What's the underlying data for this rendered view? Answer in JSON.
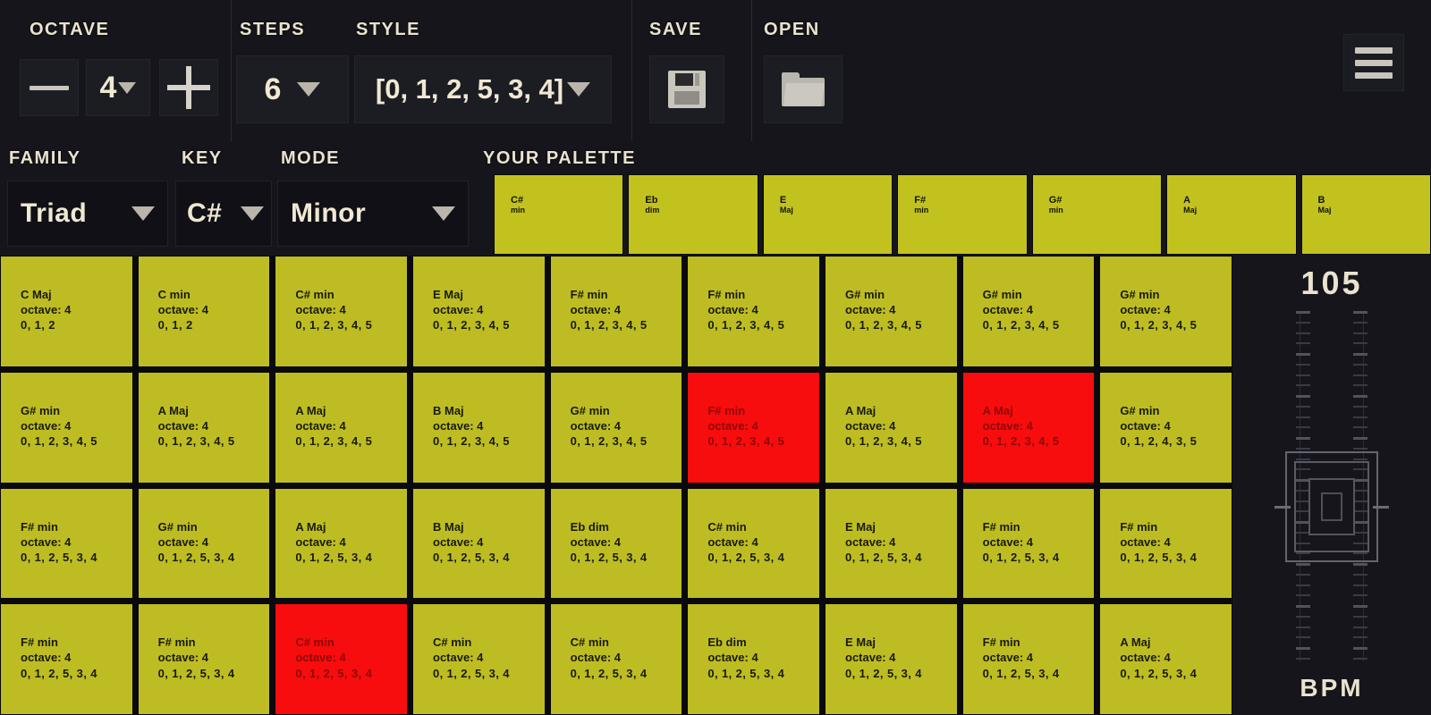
{
  "toolbar": {
    "octave": {
      "label": "OCTAVE",
      "decrement_icon": "minus-icon",
      "value": "4",
      "increment_icon": "plus-icon"
    },
    "steps": {
      "label": "STEPS",
      "value": "6"
    },
    "style": {
      "label": "STYLE",
      "value": "[0, 1, 2, 5, 3, 4]"
    },
    "save": {
      "label": "SAVE",
      "icon": "floppy-disk-icon"
    },
    "open": {
      "label": "OPEN",
      "icon": "folder-icon"
    },
    "menu": {
      "icon": "hamburger-menu-icon"
    }
  },
  "selectors": {
    "family": {
      "label": "FAMILY",
      "value": "Triad"
    },
    "key": {
      "label": "KEY",
      "value": "C#"
    },
    "mode": {
      "label": "MODE",
      "value": "Minor"
    }
  },
  "palette": {
    "label": "YOUR PALETTE",
    "chips": [
      {
        "root": "C#",
        "quality": "min"
      },
      {
        "root": "Eb",
        "quality": "dim"
      },
      {
        "root": "E",
        "quality": "Maj"
      },
      {
        "root": "F#",
        "quality": "min"
      },
      {
        "root": "G#",
        "quality": "min"
      },
      {
        "root": "A",
        "quality": "Maj"
      },
      {
        "root": "B",
        "quality": "Maj"
      }
    ]
  },
  "grid": {
    "rows": 4,
    "columns": 9,
    "active_color": "#f70d0d",
    "idle_color": "#bdbd23",
    "cells": [
      {
        "chord": "C Maj",
        "octave": "octave: 4",
        "steps": "0, 1, 2",
        "active": false
      },
      {
        "chord": "C min",
        "octave": "octave: 4",
        "steps": "0, 1, 2",
        "active": false
      },
      {
        "chord": "C# min",
        "octave": "octave: 4",
        "steps": "0, 1, 2, 3, 4, 5",
        "active": false
      },
      {
        "chord": "E Maj",
        "octave": "octave: 4",
        "steps": "0, 1, 2, 3, 4, 5",
        "active": false
      },
      {
        "chord": "F# min",
        "octave": "octave: 4",
        "steps": "0, 1, 2, 3, 4, 5",
        "active": false
      },
      {
        "chord": "F# min",
        "octave": "octave: 4",
        "steps": "0, 1, 2, 3, 4, 5",
        "active": false
      },
      {
        "chord": "G# min",
        "octave": "octave: 4",
        "steps": "0, 1, 2, 3, 4, 5",
        "active": false
      },
      {
        "chord": "G# min",
        "octave": "octave: 4",
        "steps": "0, 1, 2, 3, 4, 5",
        "active": false
      },
      {
        "chord": "G# min",
        "octave": "octave: 4",
        "steps": "0, 1, 2, 3, 4, 5",
        "active": false
      },
      {
        "chord": "G# min",
        "octave": "octave: 4",
        "steps": "0, 1, 2, 3, 4, 5",
        "active": false
      },
      {
        "chord": "A Maj",
        "octave": "octave: 4",
        "steps": "0, 1, 2, 3, 4, 5",
        "active": false
      },
      {
        "chord": "A Maj",
        "octave": "octave: 4",
        "steps": "0, 1, 2, 3, 4, 5",
        "active": false
      },
      {
        "chord": "B Maj",
        "octave": "octave: 4",
        "steps": "0, 1, 2, 3, 4, 5",
        "active": false
      },
      {
        "chord": "G# min",
        "octave": "octave: 4",
        "steps": "0, 1, 2, 3, 4, 5",
        "active": false
      },
      {
        "chord": "F# min",
        "octave": "octave: 4",
        "steps": "0, 1, 2, 3, 4, 5",
        "active": true
      },
      {
        "chord": "A Maj",
        "octave": "octave: 4",
        "steps": "0, 1, 2, 3, 4, 5",
        "active": false
      },
      {
        "chord": "A Maj",
        "octave": "octave: 4",
        "steps": "0, 1, 2, 3, 4, 5",
        "active": true
      },
      {
        "chord": "G# min",
        "octave": "octave: 4",
        "steps": "0, 1, 2, 4, 3, 5",
        "active": false
      },
      {
        "chord": "F# min",
        "octave": "octave: 4",
        "steps": "0, 1, 2, 5, 3, 4",
        "active": false
      },
      {
        "chord": "G# min",
        "octave": "octave: 4",
        "steps": "0, 1, 2, 5, 3, 4",
        "active": false
      },
      {
        "chord": "A Maj",
        "octave": "octave: 4",
        "steps": "0, 1, 2, 5, 3, 4",
        "active": false
      },
      {
        "chord": "B Maj",
        "octave": "octave: 4",
        "steps": "0, 1, 2, 5, 3, 4",
        "active": false
      },
      {
        "chord": "Eb dim",
        "octave": "octave: 4",
        "steps": "0, 1, 2, 5, 3, 4",
        "active": false
      },
      {
        "chord": "C# min",
        "octave": "octave: 4",
        "steps": "0, 1, 2, 5, 3, 4",
        "active": false
      },
      {
        "chord": "E Maj",
        "octave": "octave: 4",
        "steps": "0, 1, 2, 5, 3, 4",
        "active": false
      },
      {
        "chord": "F# min",
        "octave": "octave: 4",
        "steps": "0, 1, 2, 5, 3, 4",
        "active": false
      },
      {
        "chord": "F# min",
        "octave": "octave: 4",
        "steps": "0, 1, 2, 5, 3, 4",
        "active": false
      },
      {
        "chord": "F# min",
        "octave": "octave: 4",
        "steps": "0, 1, 2, 5, 3, 4",
        "active": false
      },
      {
        "chord": "F# min",
        "octave": "octave: 4",
        "steps": "0, 1, 2, 5, 3, 4",
        "active": false
      },
      {
        "chord": "C# min",
        "octave": "octave: 4",
        "steps": "0, 1, 2, 5, 3, 4",
        "active": true
      },
      {
        "chord": "C# min",
        "octave": "octave: 4",
        "steps": "0, 1, 2, 5, 3, 4",
        "active": false
      },
      {
        "chord": "C# min",
        "octave": "octave: 4",
        "steps": "0, 1, 2, 5, 3, 4",
        "active": false
      },
      {
        "chord": "Eb dim",
        "octave": "octave: 4",
        "steps": "0, 1, 2, 5, 3, 4",
        "active": false
      },
      {
        "chord": "E Maj",
        "octave": "octave: 4",
        "steps": "0, 1, 2, 5, 3, 4",
        "active": false
      },
      {
        "chord": "F# min",
        "octave": "octave: 4",
        "steps": "0, 1, 2, 5, 3, 4",
        "active": false
      },
      {
        "chord": "A Maj",
        "octave": "octave: 4",
        "steps": "0, 1, 2, 5, 3, 4",
        "active": false
      }
    ]
  },
  "bpm": {
    "value": "105",
    "label": "BPM"
  }
}
